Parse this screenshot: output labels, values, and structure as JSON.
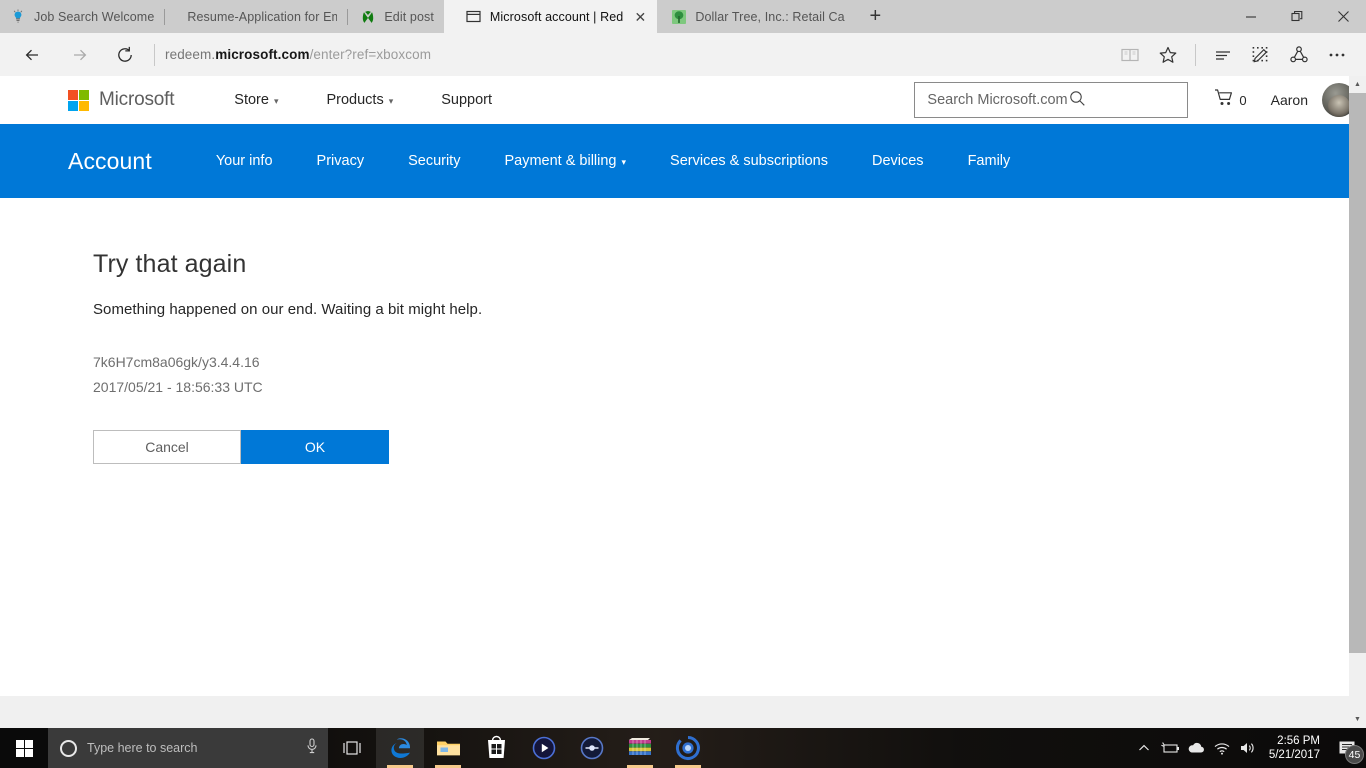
{
  "browser": {
    "tabs": [
      {
        "title": "Job Search Welcome",
        "icon": "lightbulb-icon",
        "active": false,
        "closable": false
      },
      {
        "title": "Resume-Application for Em",
        "icon": "none",
        "active": false,
        "closable": false
      },
      {
        "title": "Edit post",
        "icon": "xbox-icon",
        "active": false,
        "closable": false
      },
      {
        "title": "Microsoft account | Red",
        "icon": "window-icon",
        "active": true,
        "closable": true
      },
      {
        "title": "Dollar Tree, Inc.: Retail Caree",
        "icon": "tree-icon",
        "active": false,
        "closable": false
      }
    ],
    "new_tab_label": "+",
    "window_controls": {
      "minimize": "minimize-icon",
      "restore": "restore-icon",
      "close": "close-icon"
    },
    "nav": {
      "back": "back-arrow-icon",
      "forward": "forward-arrow-icon",
      "refresh": "refresh-icon",
      "url_prefix": "redeem.",
      "url_domain": "microsoft.com",
      "url_path": "/enter?ref=xboxcom",
      "icons": [
        "reading-view-icon",
        "favorites-star-icon",
        "hub-icon",
        "web-note-icon",
        "share-icon",
        "more-icon"
      ]
    }
  },
  "site_header": {
    "brand": "Microsoft",
    "logo_colors": [
      "#f25022",
      "#7fba00",
      "#00a4ef",
      "#ffb900"
    ],
    "nav": [
      {
        "label": "Store",
        "has_caret": true
      },
      {
        "label": "Products",
        "has_caret": true
      },
      {
        "label": "Support",
        "has_caret": false
      }
    ],
    "search_placeholder": "Search Microsoft.com",
    "cart_count": "0",
    "user_name": "Aaron"
  },
  "account_bar": {
    "title": "Account",
    "accent_color": "#0078d7",
    "items": [
      {
        "label": "Your info",
        "has_caret": false
      },
      {
        "label": "Privacy",
        "has_caret": false
      },
      {
        "label": "Security",
        "has_caret": false
      },
      {
        "label": "Payment & billing",
        "has_caret": true
      },
      {
        "label": "Services & subscriptions",
        "has_caret": false
      },
      {
        "label": "Devices",
        "has_caret": false
      },
      {
        "label": "Family",
        "has_caret": false
      }
    ]
  },
  "main": {
    "heading": "Try that again",
    "message": "Something happened on our end. Waiting a bit might help.",
    "correlation_id": "7k6H7cm8a06gk/y3.4.4.16",
    "timestamp": "2017/05/21 - 18:56:33 UTC",
    "cancel_label": "Cancel",
    "ok_label": "OK"
  },
  "taskbar": {
    "start": "windows-start-icon",
    "search_placeholder": "Type here to search",
    "mic": "microphone-icon",
    "task_view": "task-view-icon",
    "apps": [
      {
        "name": "edge-icon",
        "running": true,
        "active": true
      },
      {
        "name": "file-explorer-icon",
        "running": true,
        "active": false
      },
      {
        "name": "microsoft-store-icon",
        "running": false,
        "active": false
      },
      {
        "name": "media-player-icon",
        "running": false,
        "active": false
      },
      {
        "name": "audio-app-icon",
        "running": false,
        "active": false
      },
      {
        "name": "winrar-icon",
        "running": true,
        "active": false
      },
      {
        "name": "blue-app-icon",
        "running": true,
        "active": false
      }
    ],
    "tray": [
      "show-hidden-icons-icon",
      "battery-icon",
      "onedrive-icon",
      "wifi-icon",
      "volume-icon"
    ],
    "time": "2:56 PM",
    "date": "5/21/2017",
    "action_center": "action-center-icon",
    "notification_count": "45"
  }
}
